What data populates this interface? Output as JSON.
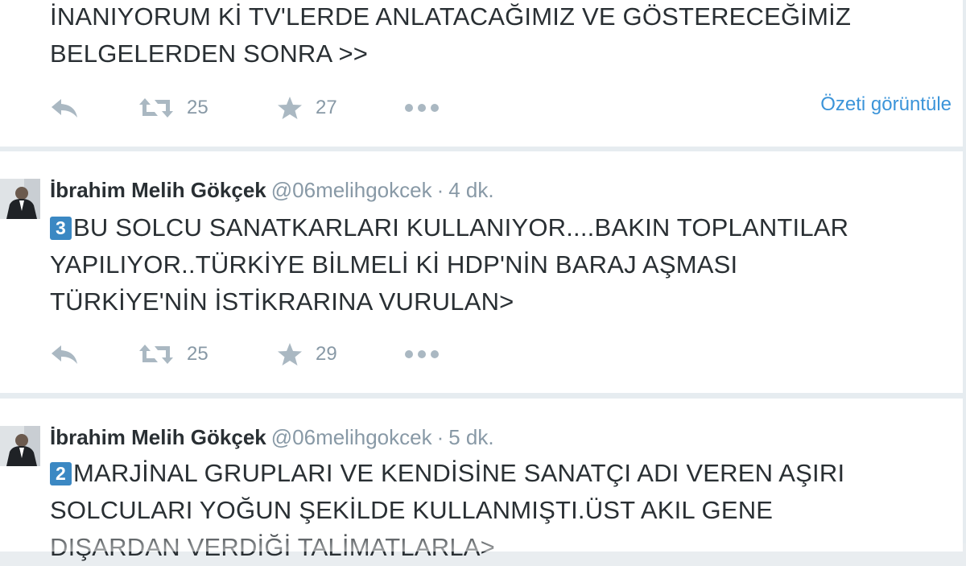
{
  "colors": {
    "link": "#3b94d9",
    "muted": "#8899a6",
    "icon": "#aab8c2",
    "badge": "#3b88c3"
  },
  "tweets": [
    {
      "lines": [
        "İNANIYORUM Kİ TV'LERDE ANLATACAĞIMIZ VE GÖSTERECEĞİMİZ",
        "BELGELERDEN SONRA >>"
      ],
      "retweets": "25",
      "favorites": "27",
      "expand_label": "Özeti görüntüle"
    },
    {
      "fullname": "İbrahim Melih Gökçek",
      "username": "@06melihgokcek",
      "sep": "·",
      "time": "4 dk.",
      "badge": "3",
      "lines": [
        "BU SOLCU SANATKARLARI KULLANIYOR....BAKIN TOPLANTILAR",
        "YAPILIYOR..TÜRKİYE BİLMELİ Kİ HDP'NİN BARAJ AŞMASI",
        "TÜRKİYE'NİN İSTİKRARINA VURULAN>"
      ],
      "retweets": "25",
      "favorites": "29"
    },
    {
      "fullname": "İbrahim Melih Gökçek",
      "username": "@06melihgokcek",
      "sep": "·",
      "time": "5 dk.",
      "badge": "2",
      "lines": [
        "MARJİNAL GRUPLARI VE KENDİSİNE SANATÇI ADI VEREN AŞIRI",
        "SOLCULARI YOĞUN ŞEKİLDE KULLANMIŞTI.ÜST AKIL GENE",
        "DIŞARDAN VERDİĞİ TALİMATLARLA>"
      ]
    }
  ]
}
